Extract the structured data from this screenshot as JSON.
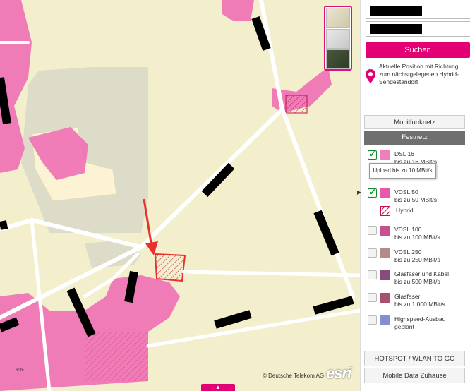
{
  "map": {
    "copyright": "© Deutsche Telekom AG",
    "esri_logo": "esri",
    "scale_label": "60m",
    "bottom_tab_icon": "chevron-up-icon",
    "layers": [
      "street-map-thumb",
      "topo-thumb",
      "satellite-thumb"
    ]
  },
  "panel": {
    "input1_value": "",
    "input2_value": "",
    "search_label": "Suchen",
    "position_text": "Aktuelle Position mit Richtung zum nächstgelegenen Hybrid-Sendestandort",
    "tabs": {
      "mobile": "Mobilfunknetz",
      "fixed": "Festnetz"
    },
    "tooltip": "Upload bis zu 10 MBit/s",
    "legend": [
      {
        "title": "DSL 16",
        "sub": "bis zu 16 MBit/s",
        "checked": true,
        "color": "#ee7fbe"
      },
      {
        "title": "VDSL 50",
        "sub": "bis zu 50 MBit/s",
        "checked": true,
        "color": "#e85aa8"
      },
      {
        "title": "Hybrid",
        "sub": "",
        "checked": null,
        "color": "#d4145a"
      },
      {
        "title": "VDSL 100",
        "sub": "bis zu 100 MBit/s",
        "checked": false,
        "color": "#c8508e"
      },
      {
        "title": "VDSL 250",
        "sub": "bis zu 250 MBit/s",
        "checked": false,
        "color": "#b58a8a"
      },
      {
        "title": "Glasfaser und Kabel",
        "sub": "bis zu 500 MBit/s",
        "checked": false,
        "color": "#8a4a7a"
      },
      {
        "title": "Glasfaser",
        "sub": "bis zu 1.000 MBit/s",
        "checked": false,
        "color": "#a85070"
      },
      {
        "title": "Highspeed-Ausbau",
        "sub": "geplant",
        "checked": false,
        "color": "#8090d0"
      }
    ],
    "bottom_buttons": {
      "hotspot": "HOTSPOT / WLAN TO GO",
      "mobile_data": "Mobile Data Zuhause"
    }
  }
}
